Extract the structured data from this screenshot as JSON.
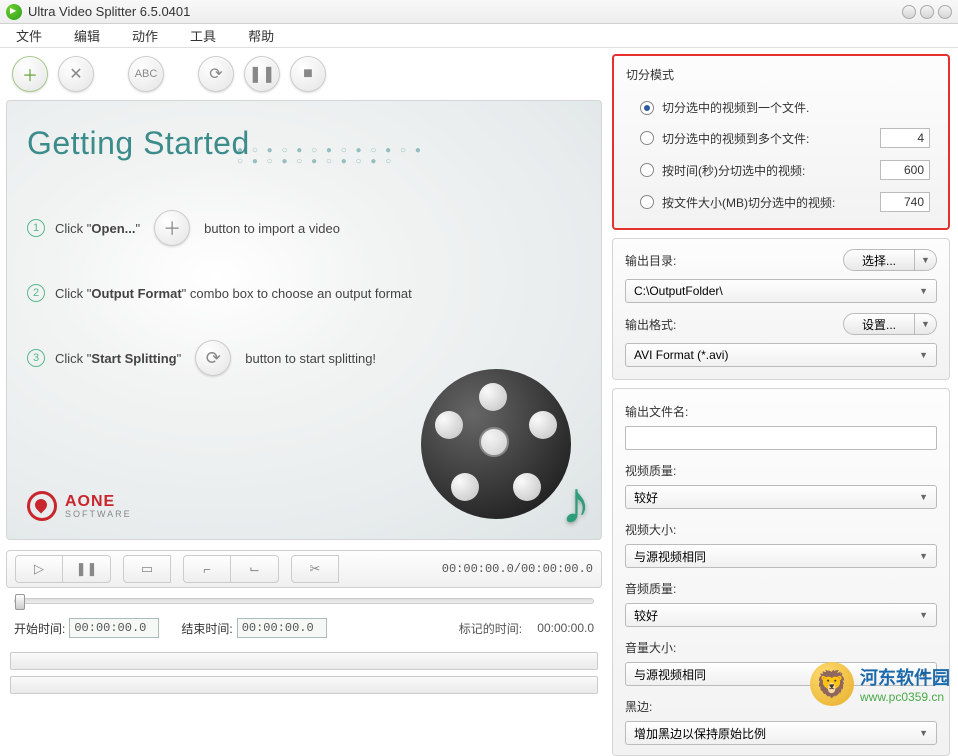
{
  "title": "Ultra Video Splitter 6.5.0401",
  "menu": {
    "file": "文件",
    "edit": "编辑",
    "action": "动作",
    "tool": "工具",
    "help": "帮助"
  },
  "toolbar": {
    "abc": "ABC"
  },
  "getting_started": {
    "heading": "Getting Started",
    "step1_a": "Click \"",
    "step1_b": "Open...",
    "step1_c": "\"",
    "step1_d": "button to import a video",
    "step2_a": "Click \"",
    "step2_b": "Output Format",
    "step2_c": "\" combo box to choose an output format",
    "step3_a": "Click \"",
    "step3_b": "Start Splitting",
    "step3_c": "\"",
    "step3_d": "button to start splitting!",
    "logo_a": "AONE",
    "logo_b": "SOFTWARE"
  },
  "playback": {
    "timecode": "00:00:00.0/00:00:00.0",
    "start_label": "开始时间:",
    "start_val": "00:00:00.0",
    "end_label": "结束时间:",
    "end_val": "00:00:00.0",
    "mark_label": "标记的时间:",
    "mark_val": "00:00:00.0"
  },
  "split_mode": {
    "title": "切分模式",
    "opt1": "切分选中的视频到一个文件.",
    "opt2": "切分选中的视频到多个文件:",
    "opt2_val": "4",
    "opt3": "按时间(秒)分切选中的视频:",
    "opt3_val": "600",
    "opt4": "按文件大小(MB)切分选中的视频:",
    "opt4_val": "740"
  },
  "output": {
    "dir_label": "输出目录:",
    "dir_btn": "选择...",
    "dir_val": "C:\\OutputFolder\\",
    "fmt_label": "输出格式:",
    "fmt_btn": "设置...",
    "fmt_val": "AVI Format (*.avi)"
  },
  "settings": {
    "name_label": "输出文件名:",
    "vq_label": "视频质量:",
    "vq_val": "较好",
    "vs_label": "视频大小:",
    "vs_val": "与源视频相同",
    "aq_label": "音频质量:",
    "aq_val": "较好",
    "vol_label": "音量大小:",
    "vol_val": "与源视频相同",
    "bb_label": "黑边:",
    "bb_val": "增加黑边以保持原始比例"
  },
  "watermark": {
    "name": "河东软件园",
    "url": "www.pc0359.cn"
  }
}
